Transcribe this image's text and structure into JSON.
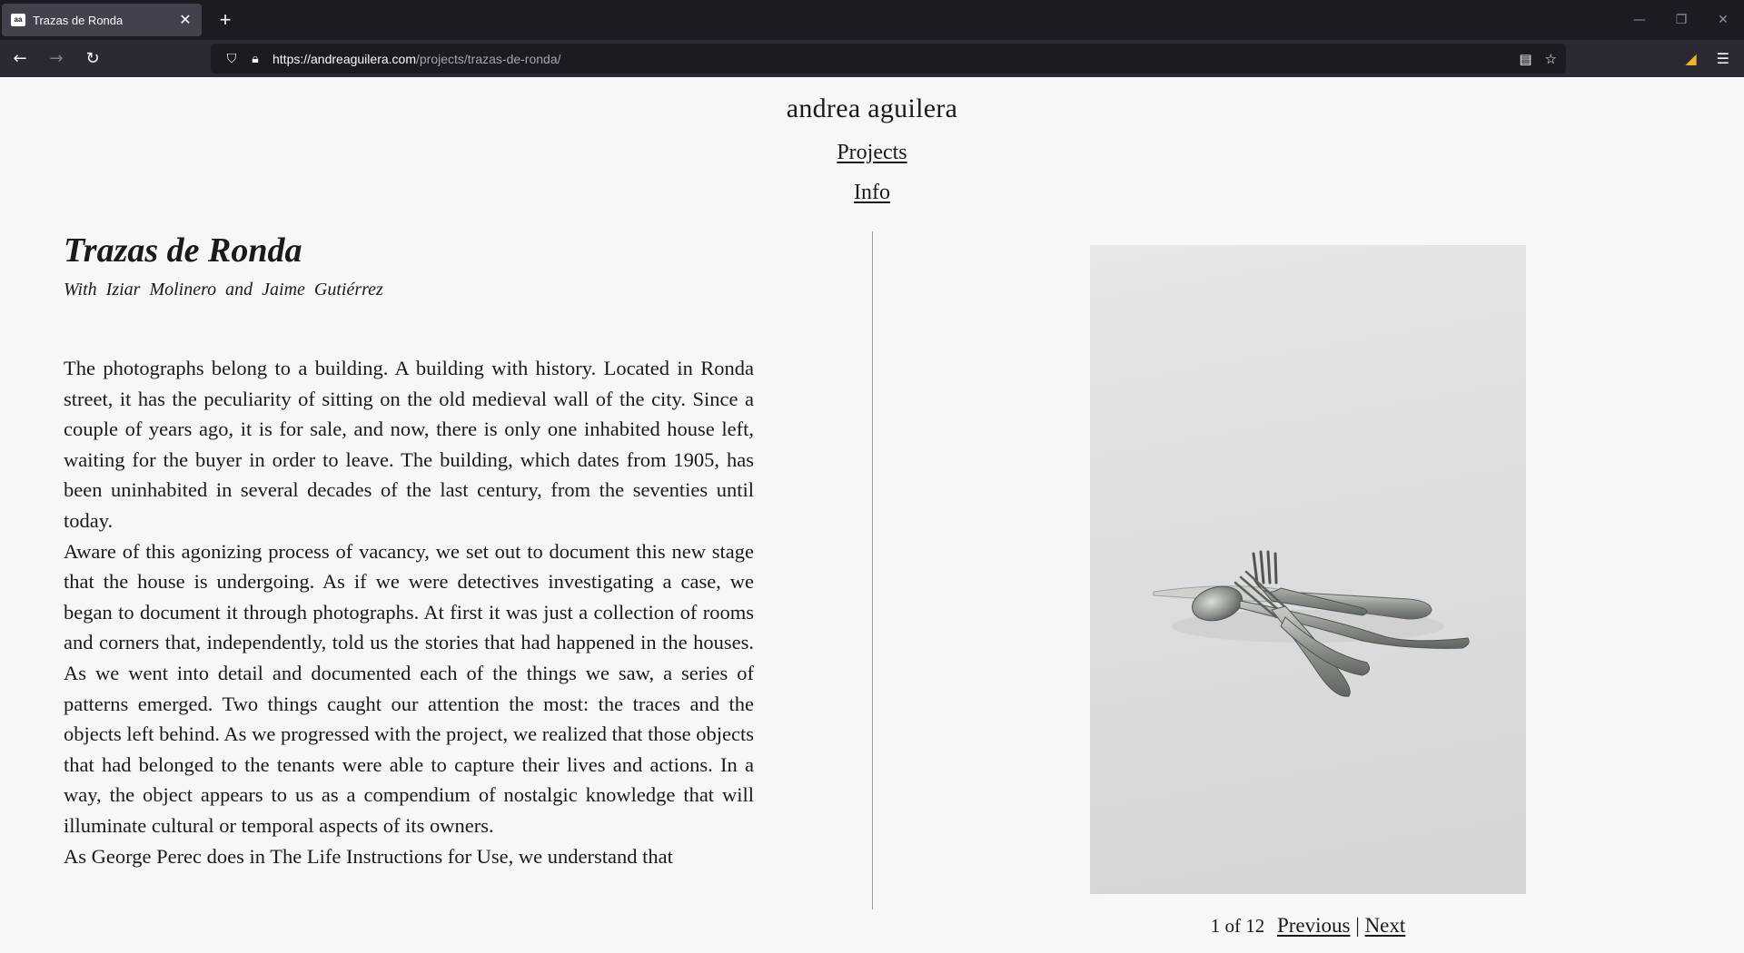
{
  "browser": {
    "tab_title": "Trazas de Ronda",
    "url_host": "https://andreaguilera.com",
    "url_path": "/projects/trazas-de-ronda/"
  },
  "site": {
    "title": "andrea aguilera",
    "nav": {
      "projects": "Projects",
      "info": "Info"
    }
  },
  "project": {
    "title": "Trazas de Ronda",
    "subtitle": "With Iziar Molinero and Jaime Gutiérrez",
    "paragraphs": [
      "The photographs belong to a building. A building with history. Located in Ronda street, it has the peculiarity of sitting on the old medieval wall of the city. Since a couple of years ago, it is for sale, and now, there is only one inhabited house left, waiting for the buyer in order to leave. The building, which dates from 1905, has been uninhabited in several decades of the last century, from the seventies until today.",
      "Aware of this agonizing process of vacancy, we set out to document this new stage that the house is undergoing. As if we were detectives investigating a case, we began to document it through photographs. At first it was just a collection of rooms and corners that, independently, told us the stories that had happened in the houses. As we went into detail and documented each of the things we saw, a series of patterns emerged. Two things caught our attention the most: the traces and the objects left behind. As we progressed with the project, we realized that those objects that had belonged to the tenants were able to capture their lives and actions. In a way, the object appears to us as a compendium of nostalgic knowledge that will illuminate cultural or temporal aspects of its owners.",
      "As George Perec does in The Life Instructions for Use, we understand that"
    ]
  },
  "gallery": {
    "counter": "1 of 12",
    "previous": "Previous",
    "separator": "|",
    "next": "Next"
  }
}
